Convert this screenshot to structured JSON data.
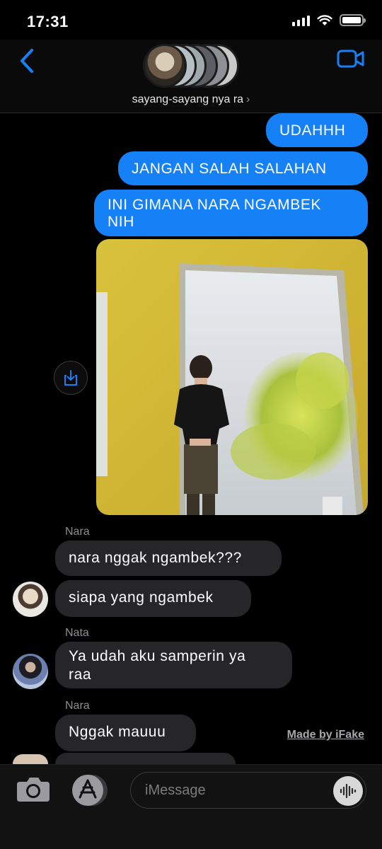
{
  "status_bar": {
    "time": "17:31",
    "icons": [
      "cellular-signal-icon",
      "wifi-icon",
      "battery-icon"
    ]
  },
  "header": {
    "group_name": "sayang-sayang nya ra",
    "chevron": "›",
    "back_icon": "chevron-left-icon",
    "video_icon": "video-camera-icon",
    "accent": "#1681f7"
  },
  "messages": {
    "sent": [
      {
        "text": "UDAHHH"
      },
      {
        "text": "JANGAN SALAH SALAHAN"
      },
      {
        "line1": "INI GIMANA NARA NGAMBEK",
        "line2": "NIH"
      }
    ],
    "received": [
      {
        "sender": "Nara",
        "texts": [
          "nara nggak ngambek???",
          "siapa yang ngambek"
        ]
      },
      {
        "sender": "Nata",
        "line1": "Ya udah aku samperin ya",
        "line2": "raa"
      },
      {
        "sender": "Nara",
        "texts": [
          "Nggak mauuu"
        ]
      }
    ]
  },
  "watermark": "Made by iFake",
  "bottom_bar": {
    "placeholder": "iMessage",
    "camera_icon": "camera-icon",
    "apps_icon": "app-store-icon",
    "audio_icon": "audio-waveform-icon"
  },
  "colors": {
    "sent_bubble": "#1681f7",
    "received_bubble": "#262628",
    "background": "#000000"
  }
}
